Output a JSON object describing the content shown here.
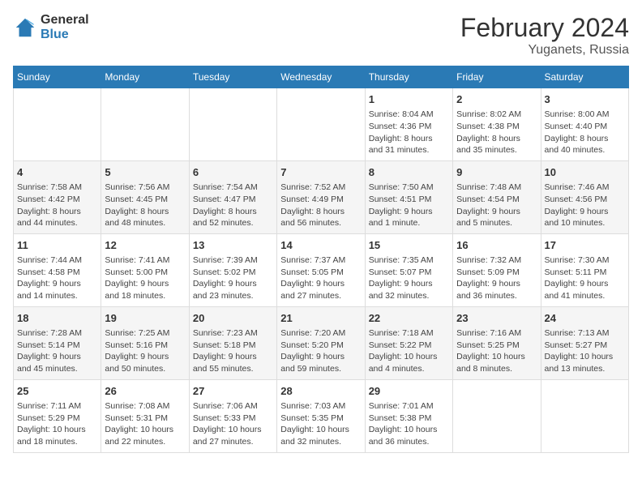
{
  "logo": {
    "general": "General",
    "blue": "Blue"
  },
  "title": "February 2024",
  "subtitle": "Yuganets, Russia",
  "weekdays": [
    "Sunday",
    "Monday",
    "Tuesday",
    "Wednesday",
    "Thursday",
    "Friday",
    "Saturday"
  ],
  "weeks": [
    [
      {
        "day": "",
        "info": ""
      },
      {
        "day": "",
        "info": ""
      },
      {
        "day": "",
        "info": ""
      },
      {
        "day": "",
        "info": ""
      },
      {
        "day": "1",
        "info": "Sunrise: 8:04 AM\nSunset: 4:36 PM\nDaylight: 8 hours\nand 31 minutes."
      },
      {
        "day": "2",
        "info": "Sunrise: 8:02 AM\nSunset: 4:38 PM\nDaylight: 8 hours\nand 35 minutes."
      },
      {
        "day": "3",
        "info": "Sunrise: 8:00 AM\nSunset: 4:40 PM\nDaylight: 8 hours\nand 40 minutes."
      }
    ],
    [
      {
        "day": "4",
        "info": "Sunrise: 7:58 AM\nSunset: 4:42 PM\nDaylight: 8 hours\nand 44 minutes."
      },
      {
        "day": "5",
        "info": "Sunrise: 7:56 AM\nSunset: 4:45 PM\nDaylight: 8 hours\nand 48 minutes."
      },
      {
        "day": "6",
        "info": "Sunrise: 7:54 AM\nSunset: 4:47 PM\nDaylight: 8 hours\nand 52 minutes."
      },
      {
        "day": "7",
        "info": "Sunrise: 7:52 AM\nSunset: 4:49 PM\nDaylight: 8 hours\nand 56 minutes."
      },
      {
        "day": "8",
        "info": "Sunrise: 7:50 AM\nSunset: 4:51 PM\nDaylight: 9 hours\nand 1 minute."
      },
      {
        "day": "9",
        "info": "Sunrise: 7:48 AM\nSunset: 4:54 PM\nDaylight: 9 hours\nand 5 minutes."
      },
      {
        "day": "10",
        "info": "Sunrise: 7:46 AM\nSunset: 4:56 PM\nDaylight: 9 hours\nand 10 minutes."
      }
    ],
    [
      {
        "day": "11",
        "info": "Sunrise: 7:44 AM\nSunset: 4:58 PM\nDaylight: 9 hours\nand 14 minutes."
      },
      {
        "day": "12",
        "info": "Sunrise: 7:41 AM\nSunset: 5:00 PM\nDaylight: 9 hours\nand 18 minutes."
      },
      {
        "day": "13",
        "info": "Sunrise: 7:39 AM\nSunset: 5:02 PM\nDaylight: 9 hours\nand 23 minutes."
      },
      {
        "day": "14",
        "info": "Sunrise: 7:37 AM\nSunset: 5:05 PM\nDaylight: 9 hours\nand 27 minutes."
      },
      {
        "day": "15",
        "info": "Sunrise: 7:35 AM\nSunset: 5:07 PM\nDaylight: 9 hours\nand 32 minutes."
      },
      {
        "day": "16",
        "info": "Sunrise: 7:32 AM\nSunset: 5:09 PM\nDaylight: 9 hours\nand 36 minutes."
      },
      {
        "day": "17",
        "info": "Sunrise: 7:30 AM\nSunset: 5:11 PM\nDaylight: 9 hours\nand 41 minutes."
      }
    ],
    [
      {
        "day": "18",
        "info": "Sunrise: 7:28 AM\nSunset: 5:14 PM\nDaylight: 9 hours\nand 45 minutes."
      },
      {
        "day": "19",
        "info": "Sunrise: 7:25 AM\nSunset: 5:16 PM\nDaylight: 9 hours\nand 50 minutes."
      },
      {
        "day": "20",
        "info": "Sunrise: 7:23 AM\nSunset: 5:18 PM\nDaylight: 9 hours\nand 55 minutes."
      },
      {
        "day": "21",
        "info": "Sunrise: 7:20 AM\nSunset: 5:20 PM\nDaylight: 9 hours\nand 59 minutes."
      },
      {
        "day": "22",
        "info": "Sunrise: 7:18 AM\nSunset: 5:22 PM\nDaylight: 10 hours\nand 4 minutes."
      },
      {
        "day": "23",
        "info": "Sunrise: 7:16 AM\nSunset: 5:25 PM\nDaylight: 10 hours\nand 8 minutes."
      },
      {
        "day": "24",
        "info": "Sunrise: 7:13 AM\nSunset: 5:27 PM\nDaylight: 10 hours\nand 13 minutes."
      }
    ],
    [
      {
        "day": "25",
        "info": "Sunrise: 7:11 AM\nSunset: 5:29 PM\nDaylight: 10 hours\nand 18 minutes."
      },
      {
        "day": "26",
        "info": "Sunrise: 7:08 AM\nSunset: 5:31 PM\nDaylight: 10 hours\nand 22 minutes."
      },
      {
        "day": "27",
        "info": "Sunrise: 7:06 AM\nSunset: 5:33 PM\nDaylight: 10 hours\nand 27 minutes."
      },
      {
        "day": "28",
        "info": "Sunrise: 7:03 AM\nSunset: 5:35 PM\nDaylight: 10 hours\nand 32 minutes."
      },
      {
        "day": "29",
        "info": "Sunrise: 7:01 AM\nSunset: 5:38 PM\nDaylight: 10 hours\nand 36 minutes."
      },
      {
        "day": "",
        "info": ""
      },
      {
        "day": "",
        "info": ""
      }
    ]
  ]
}
